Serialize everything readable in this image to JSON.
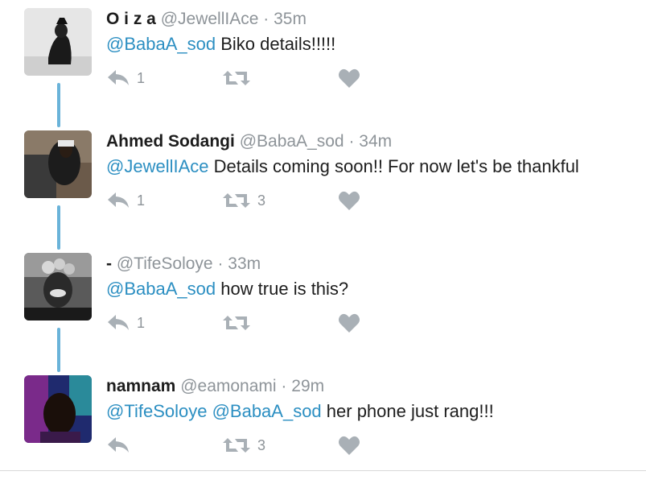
{
  "tweets": [
    {
      "name": "O i z a",
      "handle": "@JewellIAce",
      "sep": "·",
      "time": "35m",
      "mentions": "@BabaA_sod",
      "text": " Biko details!!!!!",
      "reply_count": "1",
      "retweet_count": "",
      "avatar_bg": "#bdbdbd"
    },
    {
      "name": "Ahmed Sodangi",
      "handle": "@BabaA_sod",
      "sep": "·",
      "time": "34m",
      "mentions": "@JewellIAce",
      "text": " Details coming soon!! For now let's be thankful",
      "reply_count": "1",
      "retweet_count": "3",
      "avatar_bg": "#5a4a3c"
    },
    {
      "name": "-",
      "handle": "@TifeSoloye",
      "sep": "·",
      "time": "33m",
      "mentions": "@BabaA_sod",
      "text": " how true is this?",
      "reply_count": "1",
      "retweet_count": "",
      "avatar_bg": "#4a4a4a"
    },
    {
      "name": "namnam",
      "handle": "@eamonami",
      "sep": "·",
      "time": "29m",
      "mentions": "@TifeSoloye @BabaA_sod",
      "text": " her phone just rang!!!",
      "reply_count": "",
      "retweet_count": "3",
      "avatar_bg": "#2e3a8c"
    }
  ],
  "icons": {
    "reply": "reply-icon",
    "retweet": "retweet-icon",
    "like": "heart-icon"
  },
  "colors": {
    "mention": "#2c8fc2",
    "muted": "#8e9499",
    "thread_line": "#6ab3d9",
    "icon": "#a9b0b6"
  }
}
